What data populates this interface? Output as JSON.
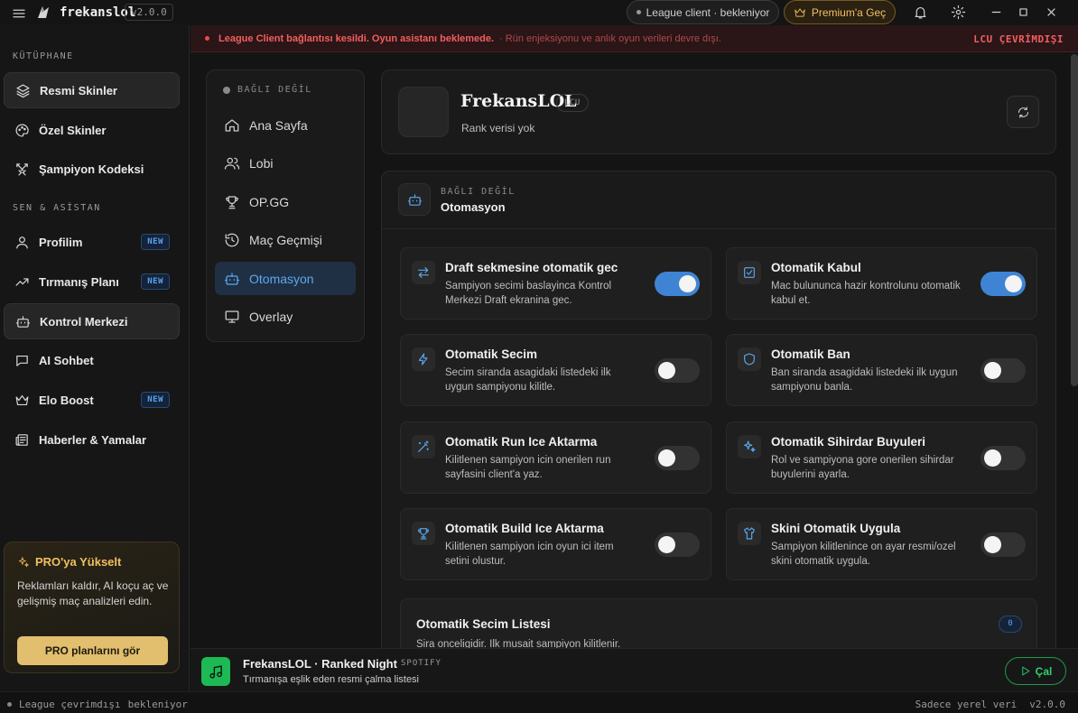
{
  "app": {
    "name": "frekanslol",
    "version": "v2.0.0"
  },
  "titlebar": {
    "client_status": "League client · bekleniyor",
    "premium_label": "Premium'a Geç"
  },
  "sidebar": {
    "library_label": "KÜTÜPHANE",
    "library_items": [
      {
        "label": "Resmi Skinler",
        "icon": "layers-icon",
        "active": true
      },
      {
        "label": "Özel Skinler",
        "icon": "palette-icon"
      },
      {
        "label": "Şampiyon Kodeksi",
        "icon": "swords-icon"
      }
    ],
    "assistant_label": "SEN & ASİSTAN",
    "assistant_items": [
      {
        "label": "Profilim",
        "icon": "user-icon",
        "badge": "NEW"
      },
      {
        "label": "Tırmanış Planı",
        "icon": "trending-up-icon",
        "badge": "NEW"
      },
      {
        "label": "Kontrol Merkezi",
        "icon": "bot-icon",
        "active": true
      },
      {
        "label": "AI Sohbet",
        "icon": "chat-icon"
      },
      {
        "label": "Elo Boost",
        "icon": "crown-icon",
        "badge": "NEW"
      },
      {
        "label": "Haberler & Yamalar",
        "icon": "newspaper-icon"
      }
    ],
    "pro": {
      "title": "PRO'ya Yükselt",
      "desc": "Reklamları kaldır, AI koçu aç ve gelişmiş maç analizleri edin.",
      "cta": "PRO planlarını gör"
    }
  },
  "banner": {
    "message": "League Client bağlantısı kesildi. Oyun asistanı beklemede.",
    "sub": "· Rün enjeksiyonu ve anlık oyun verileri devre dışı.",
    "status": "LCU ÇEVRİMDIŞI"
  },
  "inner_nav": {
    "state": "BAĞLI DEĞİL",
    "items": [
      {
        "label": "Ana Sayfa",
        "icon": "home-icon"
      },
      {
        "label": "Lobi",
        "icon": "users-icon"
      },
      {
        "label": "OP.GG",
        "icon": "trophy-icon"
      },
      {
        "label": "Maç Geçmişi",
        "icon": "history-icon"
      },
      {
        "label": "Otomasyon",
        "icon": "bot-icon",
        "active": true
      },
      {
        "label": "Overlay",
        "icon": "monitor-icon"
      }
    ]
  },
  "profile": {
    "name": "FrekansLOL",
    "badge": "LCU",
    "rank": "Rank verisi yok"
  },
  "automation": {
    "kicker": "BAĞLI DEĞİL",
    "title": "Otomasyon",
    "tiles": [
      {
        "title": "Draft sekmesine otomatik gec",
        "desc": "Sampiyon secimi baslayinca Kontrol Merkezi Draft ekranina gec.",
        "icon": "swap-icon",
        "on": true
      },
      {
        "title": "Otomatik Kabul",
        "desc": "Mac bulununca hazir kontrolunu otomatik kabul et.",
        "icon": "check-square-icon",
        "on": true
      },
      {
        "title": "Otomatik Secim",
        "desc": "Secim siranda asagidaki listedeki ilk uygun sampiyonu kilitle.",
        "icon": "bolt-icon",
        "on": false
      },
      {
        "title": "Otomatik Ban",
        "desc": "Ban siranda asagidaki listedeki ilk uygun sampiyonu banla.",
        "icon": "shield-icon",
        "on": false
      },
      {
        "title": "Otomatik Run Ice Aktarma",
        "desc": "Kilitlenen sampiyon icin onerilen run sayfasini client'a yaz.",
        "icon": "wand-icon",
        "on": false
      },
      {
        "title": "Otomatik Sihirdar Buyuleri",
        "desc": "Rol ve sampiyona gore onerilen sihirdar buyulerini ayarla.",
        "icon": "sparkles-icon",
        "on": false
      },
      {
        "title": "Otomatik Build Ice Aktarma",
        "desc": "Kilitlenen sampiyon icin oyun ici item setini olustur.",
        "icon": "trophy-icon",
        "on": false
      },
      {
        "title": "Skini Otomatik Uygula",
        "desc": "Sampiyon kilitlenince on ayar resmi/ozel skini otomatik uygula.",
        "icon": "shirt-icon",
        "on": false
      }
    ],
    "pick_list": {
      "title": "Otomatik Secim Listesi",
      "sub": "Sira onceligidir. Ilk musait sampiyon kilitlenir.",
      "count": "0"
    }
  },
  "player": {
    "title": "FrekansLOL · Ranked Night",
    "source": "SPOTIFY",
    "sub": "Tırmanışa eşlik eden resmi çalma listesi",
    "play_label": "Çal"
  },
  "statusbar": {
    "left": "League çevrimdışı",
    "left2": "bekleniyor",
    "right1": "Sadece yerel veri",
    "right2": "v2.0.0"
  }
}
